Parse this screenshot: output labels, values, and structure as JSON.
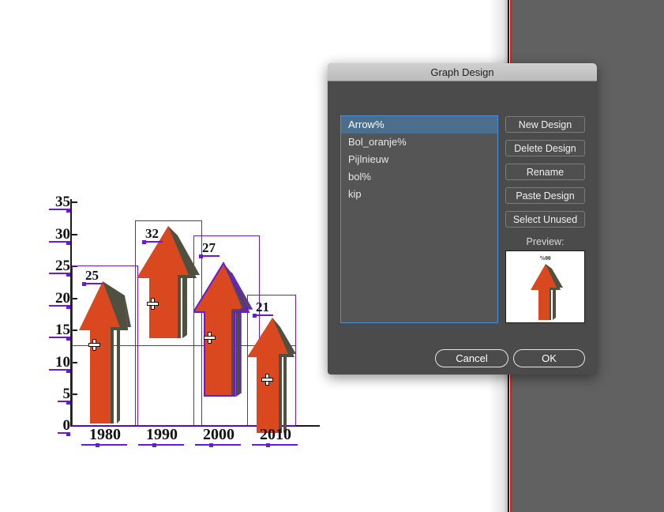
{
  "application": {
    "canvas_background": "#ffffff",
    "panel_background": "#616161",
    "artboard_guide_color": "#ee1111"
  },
  "chart_data": {
    "type": "bar",
    "title": "",
    "xlabel": "",
    "ylabel": "",
    "categories": [
      "1980",
      "1990",
      "2000",
      "2010"
    ],
    "values": [
      25,
      32,
      27,
      21
    ],
    "value_labels": [
      "25",
      "32",
      "27",
      "21"
    ],
    "ylim": [
      0,
      35
    ],
    "yticks": [
      0,
      5,
      10,
      15,
      20,
      25,
      30,
      35
    ],
    "ytick_labels": [
      "0",
      "5",
      "10",
      "15",
      "20",
      "25",
      "30",
      "35"
    ],
    "grid": false,
    "legend": "none",
    "marker_style": "arrow-graph-design",
    "series_color": "#d9481f",
    "shadow_color": "#4f5040",
    "selection_color": "#6a19d8",
    "selected_category": "2000"
  },
  "dialog": {
    "title": "Graph Design",
    "list": {
      "items": [
        {
          "label": "Arrow%",
          "selected": true
        },
        {
          "label": "Bol_oranje%",
          "selected": false
        },
        {
          "label": "Pijlnieuw",
          "selected": false
        },
        {
          "label": "bol%",
          "selected": false
        },
        {
          "label": "kip",
          "selected": false
        }
      ],
      "selection_color": "#4a6e8c",
      "border_color": "#4a90d9"
    },
    "side_buttons": [
      {
        "label": "New Design"
      },
      {
        "label": "Delete Design"
      },
      {
        "label": "Rename"
      },
      {
        "label": "Paste Design"
      },
      {
        "label": "Select Unused"
      }
    ],
    "preview": {
      "label": "Preview:",
      "caption": "%00"
    },
    "footer": {
      "cancel": "Cancel",
      "ok": "OK"
    }
  }
}
